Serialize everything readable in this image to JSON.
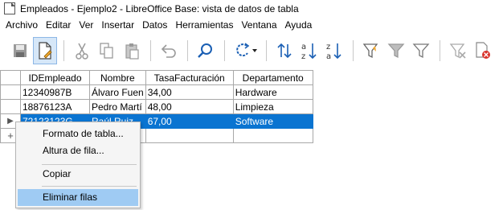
{
  "window": {
    "title": "Empleados - Ejemplo2 - LibreOffice Base: vista de datos de tabla"
  },
  "menubar": {
    "items": [
      "Archivo",
      "Editar",
      "Ver",
      "Insertar",
      "Datos",
      "Herramientas",
      "Ventana",
      "Ayuda"
    ]
  },
  "toolbar": {
    "buttons": [
      "save-icon",
      "edit-file-icon",
      "cut-icon",
      "copy-icon",
      "paste-icon",
      "undo-icon",
      "find-icon",
      "refresh-icon",
      "sort-icon",
      "sort-ascending-icon",
      "sort-descending-icon",
      "autofilter-icon",
      "standard-filter-icon",
      "filter-icon",
      "reset-filter-icon",
      "delete-record-icon"
    ]
  },
  "table": {
    "columns": [
      "IDEmpleado",
      "Nombre",
      "TasaFacturación",
      "Departamento"
    ],
    "rows": [
      [
        "12340987B",
        "Álvaro Fuen",
        "34,00",
        "Hardware"
      ],
      [
        "18876123A",
        "Pedro Martí",
        "48,00",
        "Limpieza"
      ],
      [
        "72123123G",
        "Raúl Ruiz",
        "67,00",
        "Software"
      ]
    ],
    "selected_row_index": 2
  },
  "context_menu": {
    "items": [
      "Formato de tabla...",
      "Altura de fila...",
      "Copiar",
      "Eliminar filas"
    ],
    "highlighted": "Eliminar filas"
  },
  "colors": {
    "selection": "#0a74d1",
    "menu_highlight": "#9fcbf3",
    "toolbar_active": "#d6e7f8"
  }
}
